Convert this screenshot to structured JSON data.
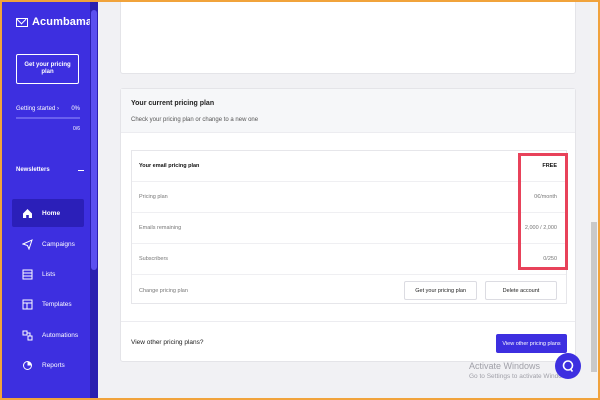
{
  "brand": {
    "name": "Acumbamail",
    "icon": "mail-icon"
  },
  "sidebar": {
    "plan_button": "Get your pricing plan",
    "getting_started": {
      "label": "Getting started ›",
      "percent": "0%",
      "progress": 0,
      "count": "0/6"
    },
    "section": {
      "label": "Newsletters",
      "icon": "minus-icon"
    },
    "items": [
      {
        "label": "Home",
        "icon": "home-icon",
        "active": true
      },
      {
        "label": "Campaigns",
        "icon": "paper-plane-icon"
      },
      {
        "label": "Lists",
        "icon": "list-icon"
      },
      {
        "label": "Templates",
        "icon": "template-icon"
      },
      {
        "label": "Automations",
        "icon": "automation-icon"
      },
      {
        "label": "Reports",
        "icon": "reports-icon"
      }
    ]
  },
  "pricing": {
    "title": "Your current pricing plan",
    "subtitle": "Check your pricing plan or change to a new one",
    "table": {
      "header_label": "Your email pricing plan",
      "header_value": "FREE",
      "rows": [
        {
          "label": "Pricing plan",
          "value": "0€/month"
        },
        {
          "label": "Emails remaining",
          "value": "2,000 / 2,000"
        },
        {
          "label": "Subscribers",
          "value": "0/250"
        }
      ],
      "change_label": "Change pricing plan",
      "get_plan_button": "Get your pricing plan",
      "delete_button": "Delete account"
    },
    "footer": {
      "text": "View other pricing plans?",
      "button": "View other pricing plans"
    }
  },
  "overlay": {
    "activate_title": "Activate Windows",
    "activate_sub": "Go to Settings to activate Windows."
  },
  "colors": {
    "brand": "#3d2fe0",
    "highlight": "#e8425a",
    "frame": "#f1a33b"
  }
}
